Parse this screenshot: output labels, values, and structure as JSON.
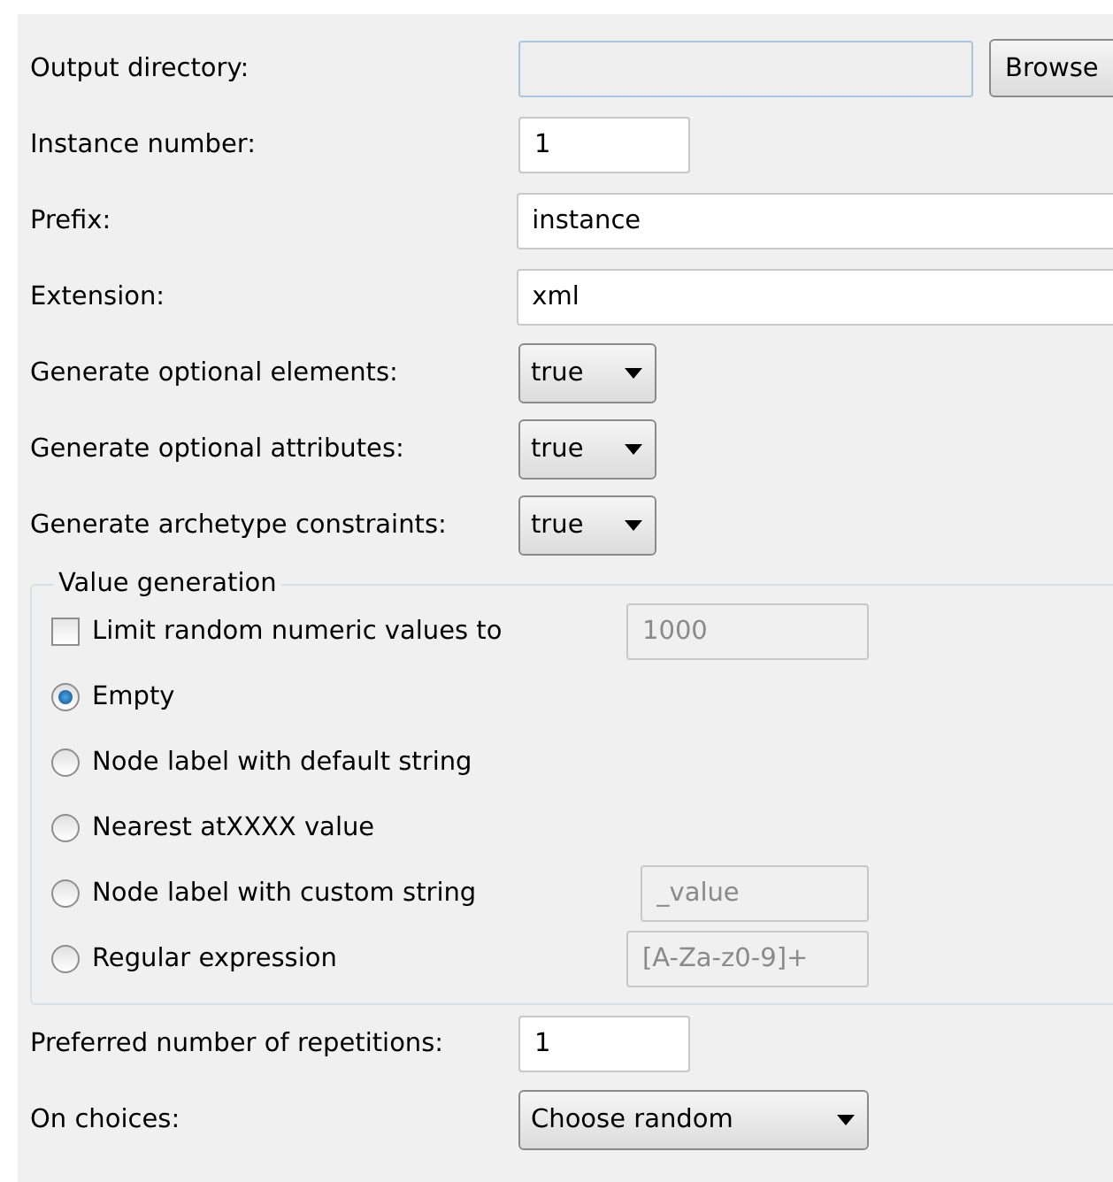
{
  "top_rows": [
    {
      "label": "Output directory:",
      "kind": "browse",
      "value": "",
      "button": "Browse"
    },
    {
      "label": "Instance number:",
      "kind": "short",
      "value": "1"
    },
    {
      "label": "Prefix:",
      "kind": "wide",
      "value": "instance"
    },
    {
      "label": "Extension:",
      "kind": "wide",
      "value": "xml"
    },
    {
      "label": "Generate optional elements:",
      "kind": "select",
      "value": "true"
    },
    {
      "label": "Generate optional attributes:",
      "kind": "select",
      "value": "true"
    },
    {
      "label": "Generate archetype constraints:",
      "kind": "select",
      "value": "true"
    }
  ],
  "value_generation": {
    "title": "Value generation",
    "limit": {
      "label": "Limit random numeric values to",
      "checked": false,
      "value": "1000"
    },
    "options": [
      {
        "label": "Empty",
        "selected": true
      },
      {
        "label": "Node label with default string",
        "selected": false
      },
      {
        "label": "Nearest atXXXX value",
        "selected": false
      },
      {
        "label": "Node label with custom string",
        "selected": false,
        "value": "_value"
      },
      {
        "label": "Regular expression",
        "selected": false,
        "value": "[A-Za-z0-9]+"
      }
    ]
  },
  "bottom_rows": [
    {
      "label": "Preferred number of repetitions:",
      "kind": "short",
      "value": "1"
    },
    {
      "label": "On choices:",
      "kind": "choice",
      "value": "Choose random"
    }
  ]
}
